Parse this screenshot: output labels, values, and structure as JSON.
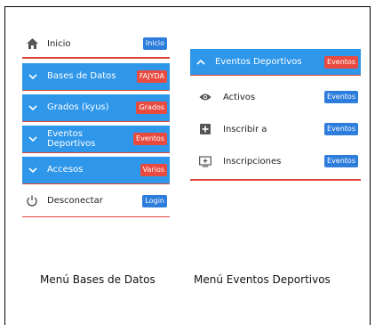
{
  "left_menu": {
    "home": {
      "label": "Inicio",
      "badge": "Inicio",
      "icon": "home-icon"
    },
    "items": [
      {
        "label": "Bases de Datos",
        "badge": "FAJYDA",
        "badge_color": "#e84a3f"
      },
      {
        "label": "Grados (kyus)",
        "badge": "Grados",
        "badge_color": "#e84a3f"
      },
      {
        "label": "Eventos Deportivos",
        "badge": "Eventos",
        "badge_color": "#e84a3f"
      },
      {
        "label": "Accesos",
        "badge": "Varios",
        "badge_color": "#e84a3f"
      }
    ],
    "logout": {
      "label": "Desconectar",
      "badge": "Login",
      "icon": "power-icon"
    }
  },
  "right_menu": {
    "header": {
      "label": "Eventos Deportivos",
      "badge": "Eventos"
    },
    "items": [
      {
        "label": "Activos",
        "badge": "Eventos",
        "icon": "eye-icon"
      },
      {
        "label": "Inscribir a",
        "badge": "Eventos",
        "icon": "plus-box-icon"
      },
      {
        "label": "Inscripciones",
        "badge": "Eventos",
        "icon": "add-to-screen-icon"
      }
    ]
  },
  "captions": {
    "left": "Menú Bases de Datos",
    "right": "Menú Eventos Deportivos"
  },
  "colors": {
    "menu_blue": "#2f97ea",
    "badge_blue": "#2d7ddc",
    "badge_red": "#e84a3f",
    "accent_red_line": "#e0443a"
  }
}
